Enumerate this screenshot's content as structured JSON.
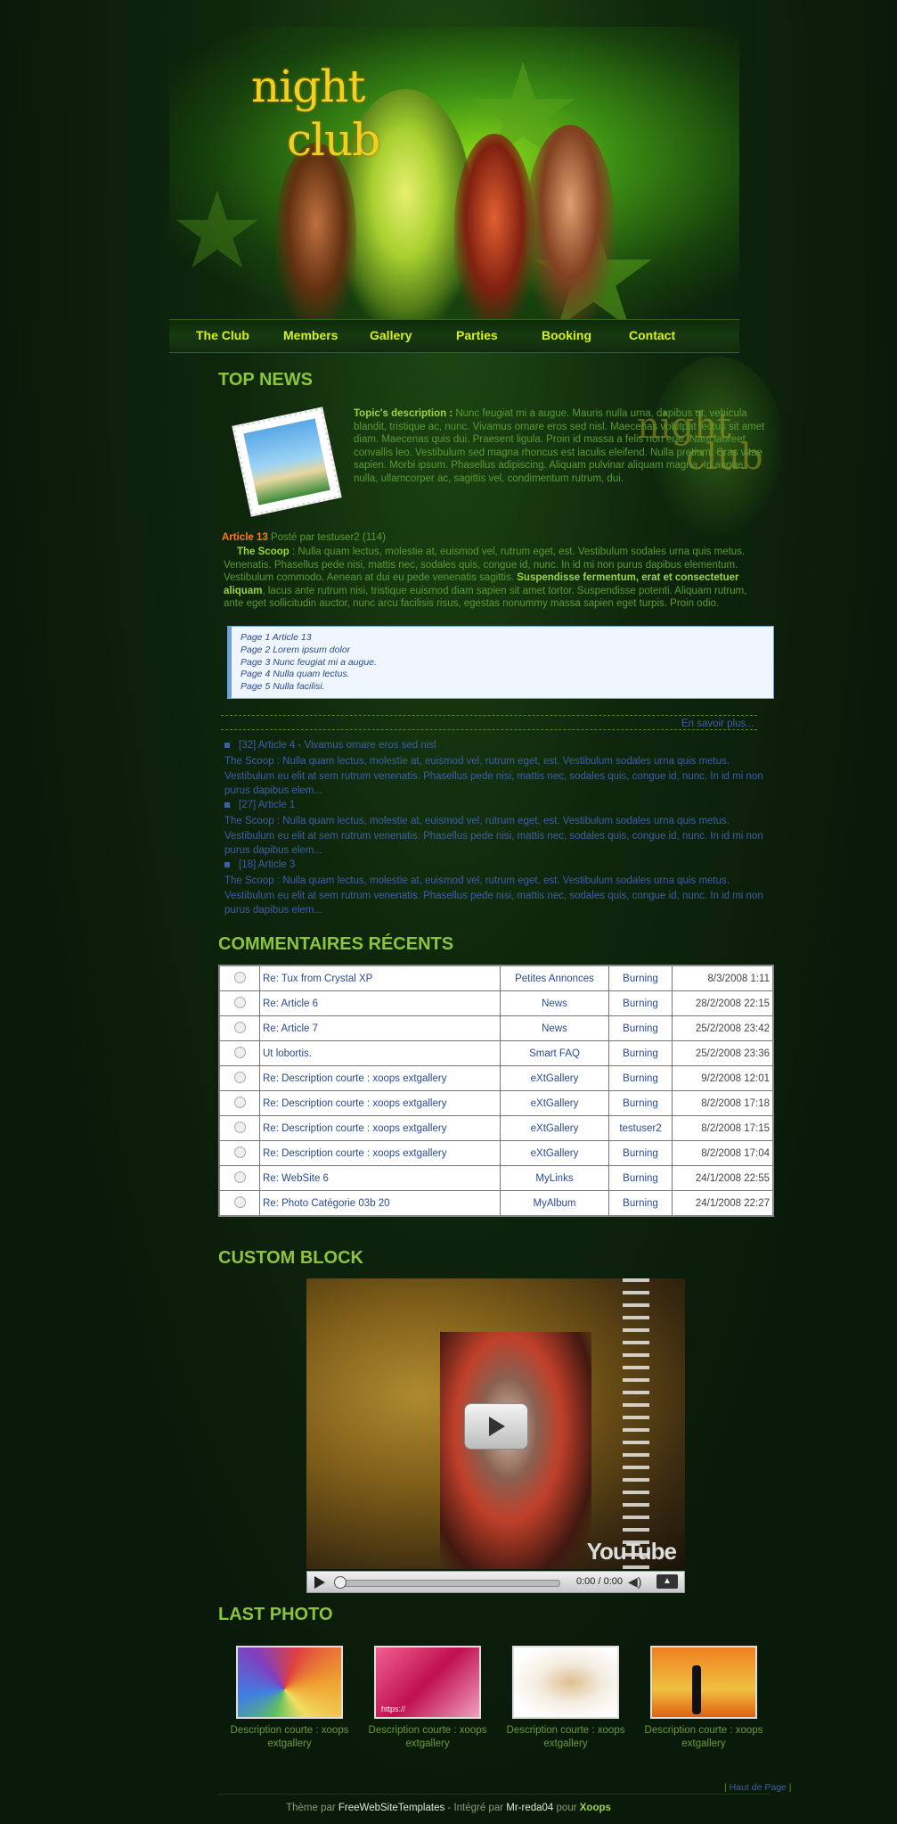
{
  "logo": {
    "line1": "night",
    "line2": "club",
    "watermark1": "night",
    "watermark2": "club"
  },
  "nav": [
    "The Club",
    "Members",
    "Gallery",
    "Parties",
    "Booking",
    "Contact"
  ],
  "top_news": {
    "heading": "TOP NEWS",
    "topic_label": "Topic's description :",
    "topic_text": "Nunc feugiat mi a augue. Mauris nulla urna, dapibus ut, vehicula blandit, tristique ac, nunc. Vivamus ornare eros sed nisl. Maecenas volutpat lectus sit amet diam. Maecenas quis dui. Praesent ligula. Proin id massa a felis non erat. Nam laoreet convallis leo. Vestibulum sed magna rhoncus est iaculis eleifend. Nulla pretium. Cras vitae sapien. Morbi ipsum. Phasellus adipiscing. Aliquam pulvinar aliquam magna. In augue nulla, ullamcorper ac, sagittis vel, condimentum rutrum, dui.",
    "article_title": "Article 13",
    "posted_by": "Posté par testuser2 (114)",
    "scoop_label": "The Scoop",
    "scoop_text_1": " : Nulla quam lectus, molestie at, euismod vel, rutrum eget, est. Vestibulum sodales urna quis metus. Venenatis. Phasellus pede nisi, mattis nec, sodales quis, congue id, nunc. In id mi non purus dapibus elementum. Vestibulum commodo. Aenean at dui eu pede venenatis sagittis. ",
    "scoop_bold": "Suspendisse fermentum, erat et consectetuer aliquam",
    "scoop_text_2": ", lacus ante rutrum nisi, tristique euismod diam sapien sit amet tortor. Suspendisse potenti. Aliquam rutrum, ante eget sollicitudin auctor, nunc arcu facilisis risus, egestas nonummy massa sapien eget turpis. Proin odio.",
    "pages": [
      "Page 1 Article 13",
      "Page 2 Lorem ipsum dolor",
      "Page 3 Nunc feugiat mi a augue.",
      "Page 4 Nulla quam lectus.",
      "Page 5 Nulla facilisi."
    ],
    "read_more": "En savoir plus...",
    "articles": [
      {
        "title": "[32] Article 4 - Vivamus ornare eros sed nisl",
        "text": "The Scoop : Nulla quam lectus, molestie at, euismod vel, rutrum eget, est. Vestibulum sodales urna quis metus. Vestibulum eu elit at sem rutrum venenatis. Phasellus pede nisi, mattis nec, sodales quis, congue id, nunc. In id mi non purus dapibus elem..."
      },
      {
        "title": "[27] Article 1",
        "text": "The Scoop : Nulla quam lectus, molestie at, euismod vel, rutrum eget, est. Vestibulum sodales urna quis metus. Vestibulum eu elit at sem rutrum venenatis. Phasellus pede nisi, mattis nec, sodales quis, congue id, nunc. In id mi non purus dapibus elem..."
      },
      {
        "title": "[18] Article 3",
        "text": "The Scoop : Nulla quam lectus, molestie at, euismod vel, rutrum eget, est. Vestibulum sodales urna quis metus. Vestibulum eu elit at sem rutrum venenatis. Phasellus pede nisi, mattis nec, sodales quis, congue id, nunc. In id mi non purus dapibus elem..."
      }
    ]
  },
  "comments": {
    "heading": "COMMENTAIRES RÉCENTS",
    "rows": [
      {
        "title": "Re: Tux from Crystal XP",
        "module": "Petites Annonces",
        "user": "Burning",
        "date": "8/3/2008 1:11"
      },
      {
        "title": "Re: Article 6",
        "module": "News",
        "user": "Burning",
        "date": "28/2/2008 22:15"
      },
      {
        "title": "Re: Article 7",
        "module": "News",
        "user": "Burning",
        "date": "25/2/2008 23:42"
      },
      {
        "title": "Ut lobortis.",
        "module": "Smart FAQ",
        "user": "Burning",
        "date": "25/2/2008 23:36"
      },
      {
        "title": "Re: Description courte : xoops extgallery",
        "module": "eXtGallery",
        "user": "Burning",
        "date": "9/2/2008 12:01"
      },
      {
        "title": "Re: Description courte : xoops extgallery",
        "module": "eXtGallery",
        "user": "Burning",
        "date": "8/2/2008 17:18"
      },
      {
        "title": "Re: Description courte : xoops extgallery",
        "module": "eXtGallery",
        "user": "testuser2",
        "date": "8/2/2008 17:15"
      },
      {
        "title": "Re: Description courte : xoops extgallery",
        "module": "eXtGallery",
        "user": "Burning",
        "date": "8/2/2008 17:04"
      },
      {
        "title": "Re: WebSite 6",
        "module": "MyLinks",
        "user": "Burning",
        "date": "24/1/2008 22:55"
      },
      {
        "title": "Re: Photo Catégorie 03b 20",
        "module": "MyAlbum",
        "user": "Burning",
        "date": "24/1/2008 22:27"
      }
    ]
  },
  "custom_block": {
    "heading": "CUSTOM BLOCK",
    "video_logo": "YouTube",
    "time": "0:00 / 0:00"
  },
  "last_photo": {
    "heading": "LAST PHOTO",
    "captions": [
      "Description courte : xoops extgallery",
      "Description courte : xoops extgallery",
      "Description courte : xoops extgallery",
      "Description courte : xoops extgallery"
    ],
    "thumb2_text": "https://"
  },
  "footer": {
    "top_link": "Haut de Page",
    "theme_by": "Thème par ",
    "fwst": "FreeWebSiteTemplates",
    "integrated": " - Intégré par ",
    "author": "Mr-reda04",
    "for": " pour ",
    "xoops": "Xoops"
  }
}
